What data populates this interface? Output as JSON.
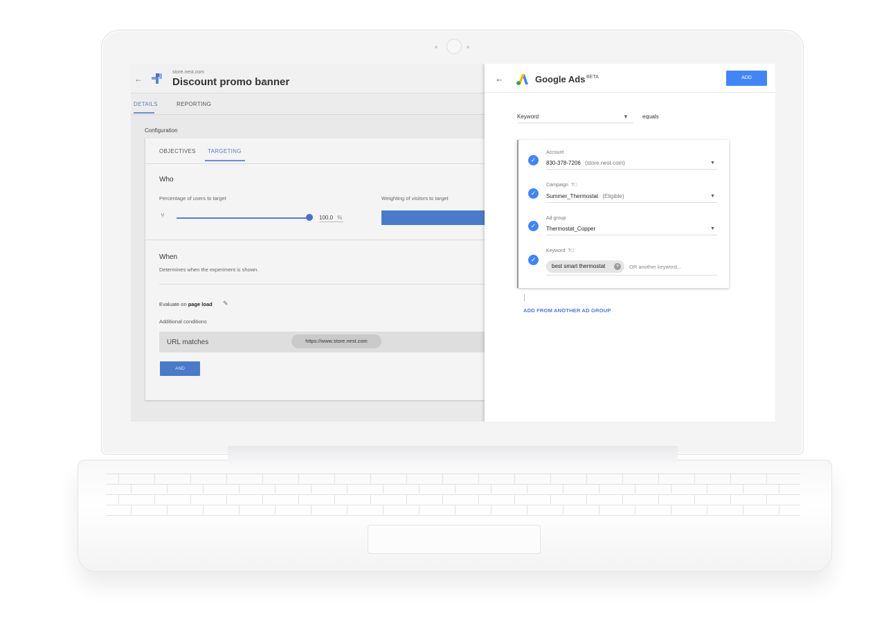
{
  "left_app": {
    "site_domain": "store.nest.com",
    "experiment_title": "Discount promo banner",
    "tabs": [
      {
        "label": "DETAILS",
        "active": true
      },
      {
        "label": "REPORTING",
        "active": false
      }
    ],
    "configuration_label": "Configuration",
    "subtabs": [
      {
        "label": "OBJECTIVES",
        "active": false
      },
      {
        "label": "TARGETING",
        "active": true
      }
    ],
    "who": {
      "heading": "Who",
      "percentage_label": "Percentage of users to target",
      "percentage_value": "100.0",
      "percentage_unit": "%",
      "slider_fraction": 1.0,
      "weighting_label": "Weighting of visitors to target"
    },
    "when": {
      "heading": "When",
      "description": "Determines when the experiment is shown.",
      "evaluate_prefix": "Evaluate on",
      "evaluate_value": "page load"
    },
    "additional_conditions_label": "Additional conditions",
    "url_condition": {
      "label": "URL matches",
      "value": "https://www.store.nest.com"
    },
    "and_button": "AND"
  },
  "right_panel": {
    "title": "Google Ads",
    "badge": "BETA",
    "add_button": "ADD",
    "filter": {
      "field": "Keyword",
      "operator": "equals"
    },
    "fields": [
      {
        "label": "Account",
        "value": "830-378-7206",
        "note": "(store.nest.com)"
      },
      {
        "label": "Campaign",
        "value": "Summer_Thermostat",
        "note": "(Eligible)"
      },
      {
        "label": "Ad group",
        "value": "Thermostat_Copper",
        "note": ""
      },
      {
        "label": "Keyword",
        "chip": "best smart thermostat",
        "placeholder": "OR another keyword..."
      }
    ],
    "add_from_another": "ADD FROM ANOTHER AD GROUP"
  },
  "icons": {
    "back": "arrow-left-icon",
    "help": "help-circle-icon",
    "edit": "pencil-icon",
    "check": "check-circle-icon",
    "remove": "remove-chip-icon"
  },
  "colors": {
    "primary_blue": "#4285f4",
    "accent_blue": "#4a7bc9"
  }
}
